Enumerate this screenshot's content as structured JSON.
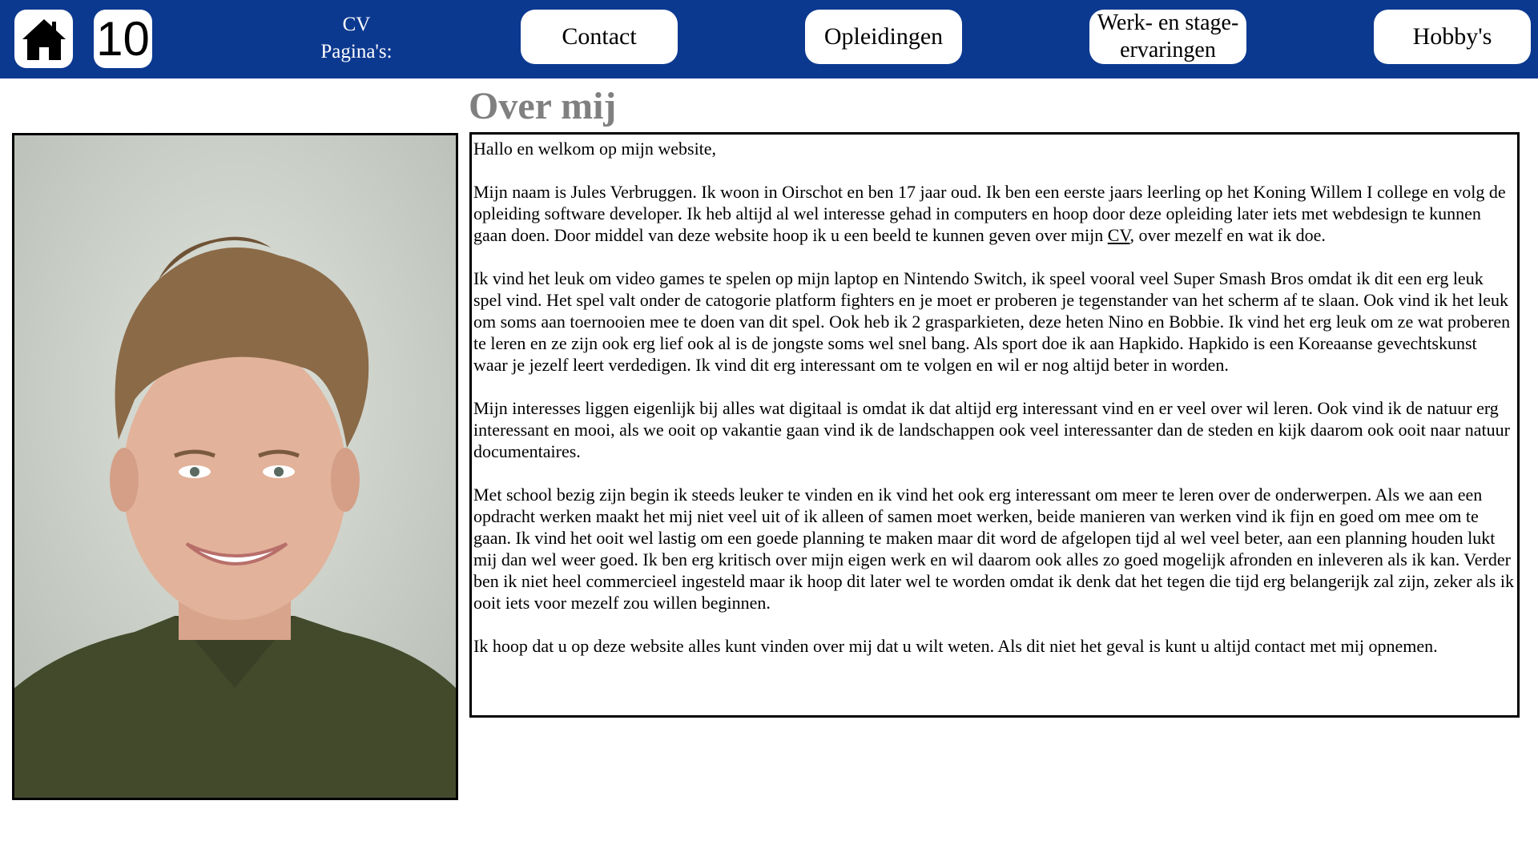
{
  "nav": {
    "home_icon": "home-icon",
    "number_label": "10",
    "cv_label_line1": "CV",
    "cv_label_line2": "Pagina's:",
    "contact_label": "Contact",
    "opleidingen_label": "Opleidingen",
    "werk_label_line1": "Werk- en stage-",
    "werk_label_line2": "ervaringen",
    "hobbys_label": "Hobby's"
  },
  "page": {
    "title": "Over mij"
  },
  "about": {
    "greeting": "Hallo en welkom op mijn website,",
    "p1_before_link": "Mijn naam is Jules Verbruggen. Ik woon in Oirschot en ben 17 jaar oud. Ik ben een eerste jaars leerling op het Koning Willem I college en volg de opleiding software developer. Ik heb altijd al wel interesse gehad in computers en hoop door deze opleiding later iets met webdesign te kunnen gaan doen. Door middel van deze website hoop ik u een beeld te kunnen geven over mijn ",
    "p1_link": "CV",
    "p1_after_link": ", over mezelf en wat ik doe.",
    "p2": "Ik vind het leuk om video games te spelen op mijn laptop en Nintendo Switch, ik speel vooral veel Super Smash Bros omdat ik dit een erg leuk spel vind. Het spel valt onder de catogorie platform fighters en je moet er proberen je tegenstander van het scherm af te slaan. Ook vind ik het leuk om soms aan toernooien mee te doen van dit spel. Ook heb ik 2 grasparkieten, deze heten Nino en Bobbie. Ik vind het erg leuk om ze wat proberen te leren en ze zijn ook erg lief ook al is de jongste soms wel snel bang. Als sport doe ik aan Hapkido. Hapkido is een Koreaanse gevechtskunst waar je jezelf leert verdedigen. Ik vind dit erg interessant om te volgen en wil er nog altijd beter in worden.",
    "p3": "Mijn interesses liggen eigenlijk bij alles wat digitaal is omdat ik dat altijd erg interessant vind en er veel over wil leren. Ook vind ik de natuur erg interessant en mooi, als we ooit op vakantie gaan vind ik de landschappen ook veel interessanter dan de steden en kijk daarom ook ooit naar natuur documentaires.",
    "p4": "Met school bezig zijn begin ik steeds leuker te vinden en ik vind het ook erg interessant om meer te leren over de onderwerpen. Als we aan een opdracht werken maakt het mij niet veel uit of ik alleen of samen moet werken, beide manieren van werken vind ik fijn en goed om mee om te gaan. Ik vind het ooit wel lastig om een goede planning te maken maar dit word de afgelopen tijd al wel veel beter, aan een planning houden lukt mij dan wel weer goed. Ik ben erg kritisch over mijn eigen werk en wil daarom ook alles zo goed mogelijk afronden en inleveren als ik kan. Verder ben ik niet heel commercieel ingesteld maar ik hoop dit later wel te worden omdat ik denk dat het tegen die tijd erg belangerijk zal zijn, zeker als ik ooit iets voor mezelf zou willen beginnen.",
    "p5": "Ik hoop dat u op deze website alles kunt vinden over mij dat u wilt weten. Als dit niet het geval is kunt u altijd contact met mij opnemen."
  },
  "colors": {
    "navbar_bg": "#0c3990",
    "title_color": "#808080"
  }
}
